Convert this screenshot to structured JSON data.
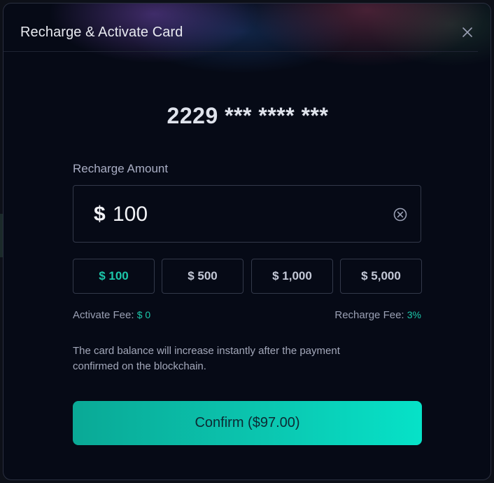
{
  "dialog": {
    "title": "Recharge & Activate Card",
    "close_icon": "close-icon"
  },
  "card": {
    "masked_number": "2229 *** **** ***"
  },
  "recharge": {
    "label": "Recharge Amount",
    "currency": "$",
    "amount": "100",
    "clear_icon": "clear-circle-icon",
    "presets": [
      {
        "label": "$ 100",
        "selected": true
      },
      {
        "label": "$ 500",
        "selected": false
      },
      {
        "label": "$ 1,000",
        "selected": false
      },
      {
        "label": "$ 5,000",
        "selected": false
      }
    ]
  },
  "fees": {
    "activate_label": "Activate Fee:",
    "activate_value": "$ 0",
    "recharge_label": "Recharge Fee:",
    "recharge_value": "3%"
  },
  "info": {
    "text": "The card balance will increase instantly after the payment confirmed on the blockchain."
  },
  "confirm": {
    "label": "Confirm ($97.00)"
  },
  "colors": {
    "accent": "#1cc7aa",
    "background": "#060a16",
    "button_gradient_start": "#0aa996",
    "button_gradient_end": "#06e2c8"
  }
}
